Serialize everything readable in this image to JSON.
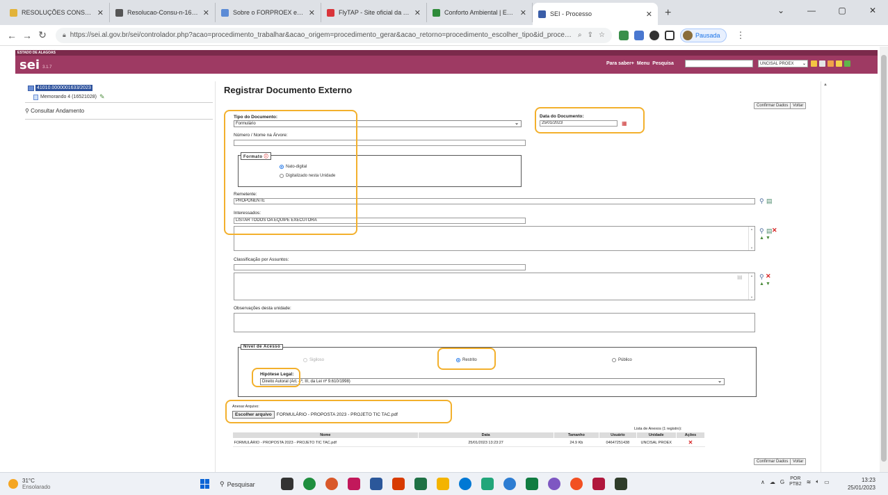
{
  "browser": {
    "tabs": [
      {
        "label": "RESOLUÇÕES CONSU - 20",
        "fav_color": "#e2b33a",
        "active": false
      },
      {
        "label": "Resolucao-Consu-n-16-20",
        "fav_color": "#555555",
        "active": false
      },
      {
        "label": "Sobre o FORPROEX e a REN",
        "fav_color": "#5b8bd6",
        "active": false
      },
      {
        "label": "FlyTAP - Site oficial da TAP",
        "fav_color": "#d9343a",
        "active": false
      },
      {
        "label": "Conforto Ambiental | Enca",
        "fav_color": "#2e8b3a",
        "active": false
      },
      {
        "label": "SEI - Processo",
        "fav_color": "#3b5ea8",
        "active": true
      }
    ],
    "new_tab_glyph": "+",
    "url": "https://sei.al.gov.br/sei/controlador.php?acao=procedimento_trabalhar&acao_origem=procedimento_gerar&acao_retorno=procedimento_escolher_tipo&id_procedi...",
    "profile_label": "Pausada"
  },
  "sei": {
    "org": "ESTADO DE ALAGOAS",
    "logo": "sei",
    "version": "3.1.7",
    "header_links": [
      "Para saber+",
      "Menu",
      "Pesquisa"
    ],
    "unit_select": "UNCISAL PROEX",
    "process_number": "41010.0000001633/2023",
    "doc_node": "Memorando 4 (16521028)",
    "andamento_link": "Consultar Andamento"
  },
  "form": {
    "title": "Registrar Documento Externo",
    "confirm_label": "Confirmar Dados",
    "back_label": "Voltar",
    "tipo_label": "Tipo do Documento:",
    "tipo_value": "Formulário",
    "data_label": "Data do Documento:",
    "data_value": "25/01/2023",
    "numero_label": "Número / Nome na Árvore:",
    "formato_legend": "Formato",
    "formato_nato": "Nato-digital",
    "formato_digitalizado": "Digitalizado nesta Unidade",
    "remetente_label": "Remetente:",
    "remetente_value": "PROPONENTE",
    "interessados_label": "Interessados:",
    "interessados_value": "LISTAR TODOS OA EQUIPE EXECUTORA",
    "classificacao_label": "Classificação por Assuntos:",
    "observacoes_label": "Observações desta unidade:",
    "nivel_legend": "Nível de Acesso",
    "nivel_sigiloso": "Sigiloso",
    "nivel_restrito": "Restrito",
    "nivel_publico": "Público",
    "hipotese_label": "Hipótese Legal:",
    "hipotese_value": "Direito Autoral (Art. 4º, III, da Lei nº 9.610/1998)",
    "anexar_label": "Anexar Arquivo:",
    "choose_file_label": "Escolher arquivo",
    "chosen_file": "FORMULÁRIO - PROPOSTA 2023 - PROJETO TIC TAC.pdf",
    "anexos_caption": "Lista de Anexos (1 registro):",
    "anexos_headers": [
      "Nome",
      "Data",
      "Tamanho",
      "Usuário",
      "Unidade",
      "Ações"
    ],
    "anexos_rows": [
      {
        "nome": "FORMULÁRIO - PROPOSTA 2023 - PROJETO TIC TAC.pdf",
        "data": "25/01/2023 13:23:27",
        "tamanho": "24.9 Kb",
        "usuario": "04647251438",
        "unidade": "UNCISAL PROEX"
      }
    ]
  },
  "taskbar": {
    "temp": "31°C",
    "weather": "Ensolarado",
    "search_label": "Pesquisar",
    "lang_top": "POR",
    "lang_bottom": "PTB2",
    "time": "13:23",
    "date": "25/01/2023"
  },
  "colors": {
    "sei_bar": "#9e3a63",
    "sei_top": "#7b2a4b",
    "highlight": "#f3b02c",
    "selected_process": "#2a4f9b"
  }
}
